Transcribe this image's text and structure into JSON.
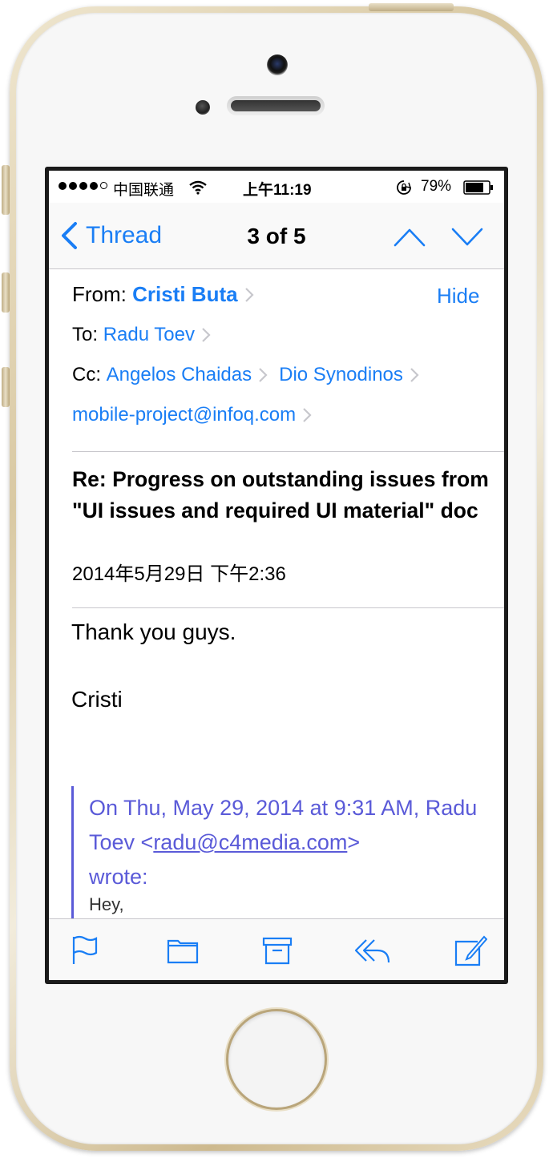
{
  "status_bar": {
    "carrier": "中国联通",
    "time": "上午11:19",
    "battery": "79%"
  },
  "nav": {
    "back_label": "Thread",
    "title": "3 of 5"
  },
  "header": {
    "from_label": "From:",
    "from_name": "Cristi Buta",
    "hide_label": "Hide",
    "to_label": "To:",
    "to_name": "Radu Toev",
    "cc_label": "Cc:",
    "cc": [
      "Angelos Chaidas",
      "Dio Synodinos",
      "mobile-project@infoq.com"
    ]
  },
  "message": {
    "subject": "Re: Progress on outstanding issues from \"UI issues and required UI material\" doc",
    "date": "2014年5月29日 下午2:36",
    "body_lines": [
      "Thank you guys.",
      "Cristi"
    ],
    "quote_intro": "On Thu, May 29, 2014 at 9:31 AM, Radu Toev <",
    "quote_email": "radu@c4media.com",
    "quote_after_email": ">",
    "quote_wrote": "wrote:",
    "quote_text": "Hey,"
  },
  "colors": {
    "accent": "#1a7ef5",
    "quote": "#5a5ad8"
  },
  "toolbar_icons": [
    "flag-icon",
    "folder-icon",
    "archive-icon",
    "reply-icon",
    "compose-icon"
  ]
}
